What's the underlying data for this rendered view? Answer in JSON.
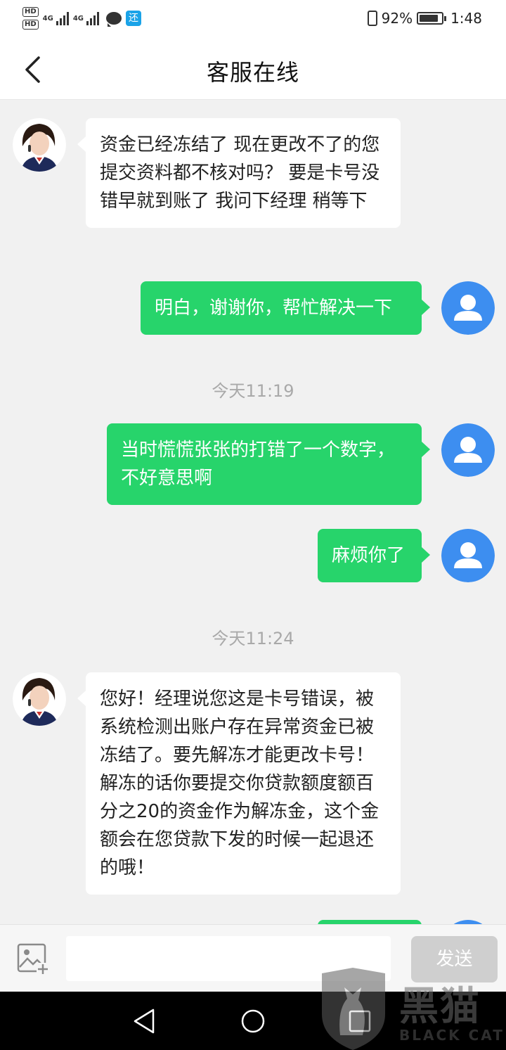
{
  "status_bar": {
    "hd1": "HD",
    "hd2": "HD",
    "net1": "4G",
    "net2": "4G",
    "app_badge": "还",
    "battery": "92%",
    "time": "1:48"
  },
  "header": {
    "title": "客服在线",
    "back_icon": "chevron-left-icon"
  },
  "messages": [
    {
      "side": "left",
      "text": "资金已经冻结了 现在更改不了的您提交资料都不核对吗？ 要是卡号没错早就到账了 我问下经理 稍等下"
    },
    {
      "side": "right",
      "text": "明白，谢谢你，帮忙解决一下"
    },
    {
      "type": "time",
      "text": "今天11:19"
    },
    {
      "side": "right",
      "text": "当时慌慌张张的打错了一个数字，不好意思啊"
    },
    {
      "side": "right",
      "text": "麻烦你了"
    },
    {
      "type": "time",
      "text": "今天11:24"
    },
    {
      "side": "left",
      "text": "您好！经理说您这是卡号错误，被系统检测出账户存在异常资金已被冻结了。要先解冻才能更改卡号！ 解冻的话你要提交你贷款额度额百分之20的资金作为解冻金，这个金额会在您贷款下发的时候一起退还的哦！"
    }
  ],
  "input_bar": {
    "placeholder": "",
    "send_label": "发送",
    "image_icon": "add-image-icon"
  },
  "watermark": {
    "cn": "黑猫",
    "en": "BLACK CAT"
  },
  "colors": {
    "bubble_green": "#27d46b",
    "user_avatar_blue": "#3d8ef0",
    "background": "#f1f1f1"
  }
}
